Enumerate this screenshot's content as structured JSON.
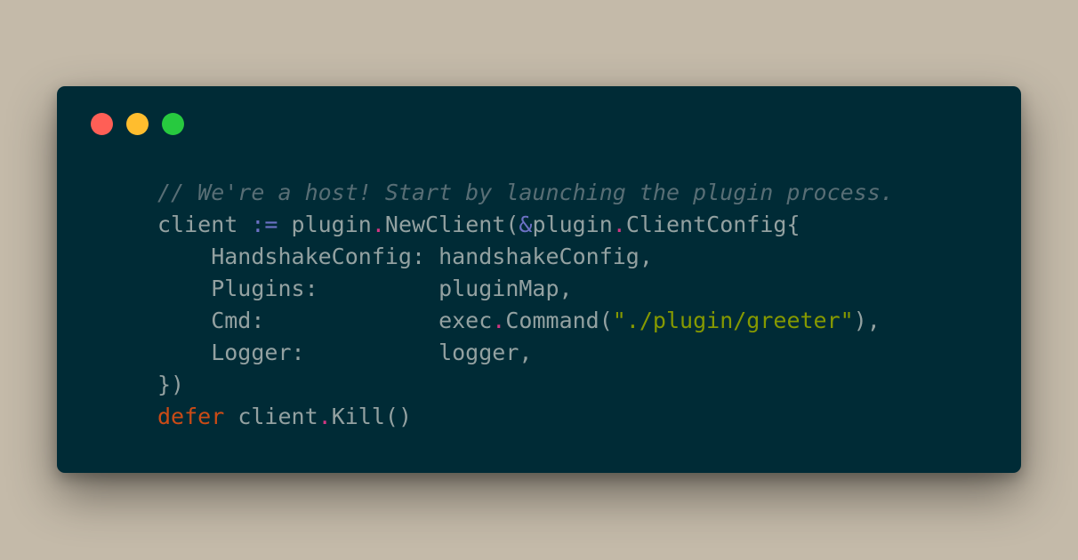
{
  "window": {
    "traffic_lights": [
      {
        "name": "close",
        "color": "#ff5f56"
      },
      {
        "name": "minimize",
        "color": "#ffbd2e"
      },
      {
        "name": "zoom",
        "color": "#27c93f"
      }
    ]
  },
  "code": {
    "language": "go",
    "theme_colors": {
      "background": "#002b36",
      "text": "#93a1a1",
      "comment": "#586e75",
      "operator": "#6c71c4",
      "dot": "#d33682",
      "string": "#859900",
      "keyword": "#cb4b16"
    },
    "lines": [
      {
        "tokens": [
          {
            "t": "// We're a host! Start by launching the plugin process.",
            "k": "comment"
          }
        ]
      },
      {
        "tokens": [
          {
            "t": "client ",
            "k": "plain"
          },
          {
            "t": ":=",
            "k": "op"
          },
          {
            "t": " plugin",
            "k": "plain"
          },
          {
            "t": ".",
            "k": "dot"
          },
          {
            "t": "NewClient(",
            "k": "plain"
          },
          {
            "t": "&",
            "k": "op"
          },
          {
            "t": "plugin",
            "k": "plain"
          },
          {
            "t": ".",
            "k": "dot"
          },
          {
            "t": "ClientConfig{",
            "k": "plain"
          }
        ]
      },
      {
        "tokens": [
          {
            "t": "    HandshakeConfig: handshakeConfig,",
            "k": "plain"
          }
        ]
      },
      {
        "tokens": [
          {
            "t": "    Plugins:         pluginMap,",
            "k": "plain"
          }
        ]
      },
      {
        "tokens": [
          {
            "t": "    Cmd:             exec",
            "k": "plain"
          },
          {
            "t": ".",
            "k": "dot"
          },
          {
            "t": "Command(",
            "k": "plain"
          },
          {
            "t": "\"./plugin/greeter\"",
            "k": "string"
          },
          {
            "t": "),",
            "k": "plain"
          }
        ]
      },
      {
        "tokens": [
          {
            "t": "    Logger:          logger,",
            "k": "plain"
          }
        ]
      },
      {
        "tokens": [
          {
            "t": "})",
            "k": "plain"
          }
        ]
      },
      {
        "tokens": [
          {
            "t": "defer",
            "k": "keyword"
          },
          {
            "t": " client",
            "k": "plain"
          },
          {
            "t": ".",
            "k": "dot"
          },
          {
            "t": "Kill()",
            "k": "plain"
          }
        ]
      }
    ]
  }
}
